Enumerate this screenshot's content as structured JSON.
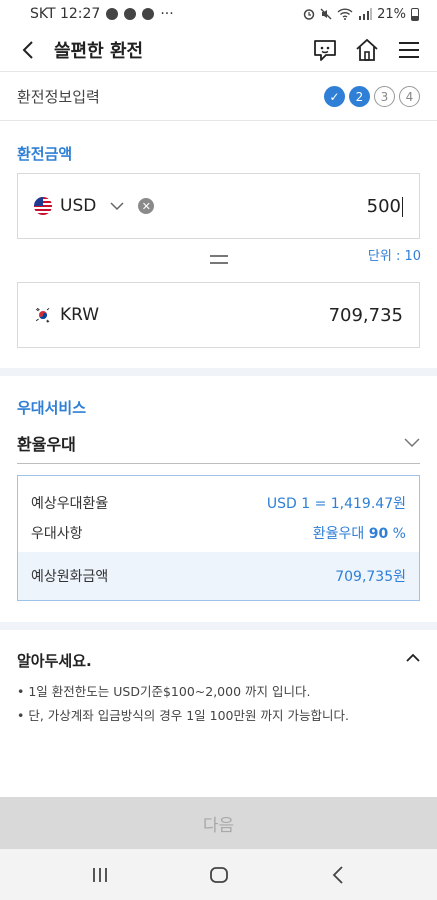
{
  "status_bar": {
    "carrier_time": "SKT 12:27",
    "more": "···",
    "battery_pct": "21%"
  },
  "header": {
    "title": "쓸편한 환전"
  },
  "steps": {
    "title": "환전정보입력",
    "items": [
      "✓",
      "2",
      "3",
      "4"
    ]
  },
  "exchange": {
    "section_label": "환전금액",
    "from": {
      "currency": "USD",
      "amount": "500"
    },
    "unit_label": "단위 : 10",
    "to": {
      "currency": "KRW",
      "amount": "709,735"
    }
  },
  "benefit": {
    "section_label": "우대서비스",
    "selected": "환율우대",
    "rows": [
      {
        "label": "예상우대환율",
        "value": "USD 1 = 1,419.47원"
      },
      {
        "label": "우대사항",
        "value_prefix": "환율우대 ",
        "value_strong": "90",
        "value_suffix": " %"
      }
    ],
    "total": {
      "label": "예상원화금액",
      "value": "709,735원"
    }
  },
  "notice": {
    "title": "알아두세요.",
    "items": [
      "• 1일 환전한도는 USD기준$100~2,000 까지 입니다.",
      "• 단, 가상계좌 입금방식의 경우 1일 100만원 까지 가능합니다."
    ]
  },
  "footer": {
    "next_label": "다음"
  },
  "colors": {
    "accent": "#2f7fd6",
    "disabled": "#d9d9d9"
  }
}
